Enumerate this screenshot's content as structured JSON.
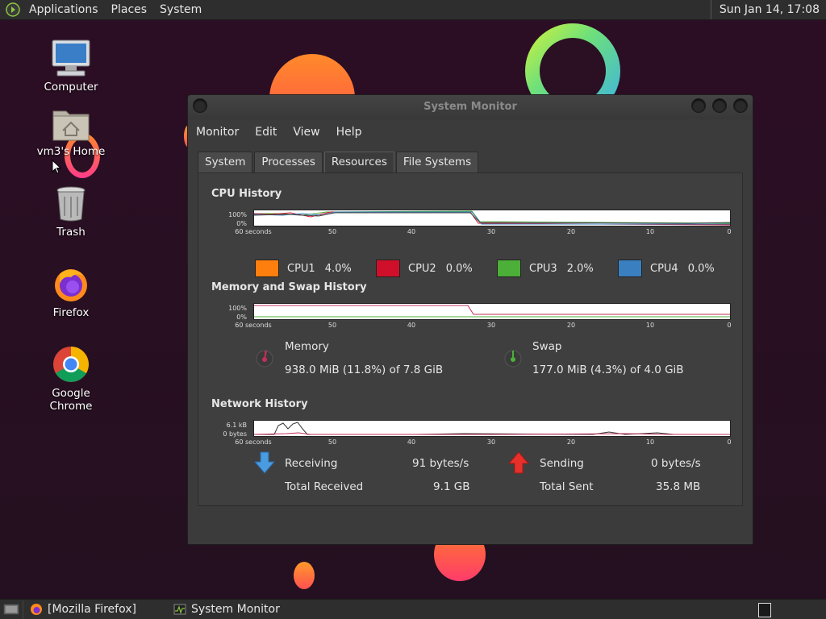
{
  "top_panel": {
    "menus": [
      "Applications",
      "Places",
      "System"
    ],
    "clock": "Sun Jan 14, 17:08"
  },
  "desktop_icons": [
    {
      "label": "Computer",
      "icon": "computer-icon"
    },
    {
      "label": "vm3's Home",
      "icon": "home-folder-icon"
    },
    {
      "label": "Trash",
      "icon": "trash-icon"
    },
    {
      "label": "Firefox",
      "icon": "firefox-icon"
    },
    {
      "label": "Google Chrome",
      "icon": "chrome-icon"
    }
  ],
  "window": {
    "title": "System Monitor",
    "menus": [
      "Monitor",
      "Edit",
      "View",
      "Help"
    ],
    "tabs": [
      "System",
      "Processes",
      "Resources",
      "File Systems"
    ],
    "active_tab": "Resources"
  },
  "cpu": {
    "title": "CPU History",
    "y_top": "100%",
    "y_bottom": "0%",
    "legend": [
      {
        "name": "CPU1",
        "value": "4.0%",
        "color": "#ff7f0e"
      },
      {
        "name": "CPU2",
        "value": "0.0%",
        "color": "#d0102a"
      },
      {
        "name": "CPU3",
        "value": "2.0%",
        "color": "#4caf38"
      },
      {
        "name": "CPU4",
        "value": "0.0%",
        "color": "#3a80c0"
      }
    ]
  },
  "memory": {
    "title": "Memory and Swap History",
    "y_top": "100%",
    "y_bottom": "0%",
    "memory_label": "Memory",
    "memory_value": "938.0 MiB (11.8%) of 7.8 GiB",
    "swap_label": "Swap",
    "swap_value": "177.0 MiB (4.3%) of 4.0 GiB",
    "memory_color": "#c0305a",
    "swap_color": "#4caf38"
  },
  "network": {
    "title": "Network History",
    "y_top": "6.1 kB",
    "y_bottom": "0 bytes",
    "receiving_label": "Receiving",
    "receiving_value": "91 bytes/s",
    "total_received_label": "Total Received",
    "total_received_value": "9.1 GB",
    "sending_label": "Sending",
    "sending_value": "0 bytes/s",
    "total_sent_label": "Total Sent",
    "total_sent_value": "35.8 MB"
  },
  "x_ticks": [
    "60 seconds",
    "50",
    "40",
    "30",
    "20",
    "10",
    "0"
  ],
  "taskbar": [
    {
      "label": "[Mozilla Firefox]",
      "icon": "firefox-icon"
    },
    {
      "label": "System Monitor",
      "icon": "system-monitor-icon"
    }
  ]
}
